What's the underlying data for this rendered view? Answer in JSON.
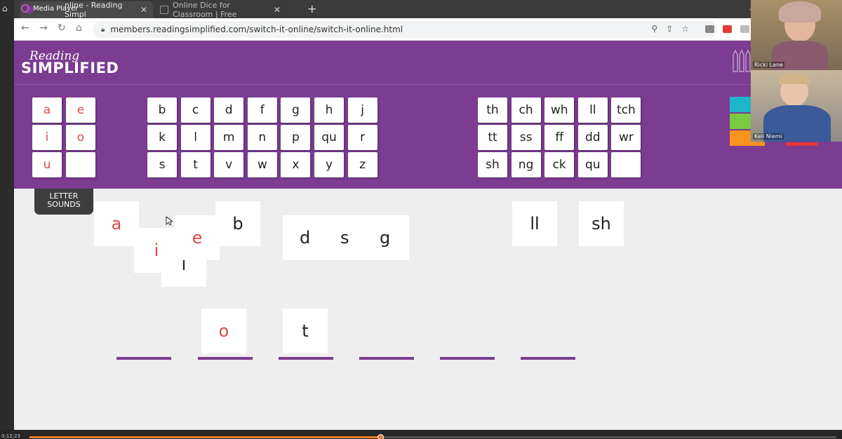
{
  "media_player": {
    "title": "Media Player",
    "timestamp": "0:12:23",
    "progress_percent": 43.5
  },
  "browser": {
    "tabs": [
      {
        "label": "nline - Reading Simpl",
        "active": true
      },
      {
        "label": "Online Dice for Classroom | Free",
        "active": false
      }
    ],
    "url": "members.readingsimplified.com/switch-it-online/switch-it-online.html",
    "new_tab_label": "+"
  },
  "app": {
    "logo_top": "Reading",
    "logo_main": "SIMPLIFIED",
    "vowels": [
      "a",
      "e",
      "i",
      "o",
      "u",
      ""
    ],
    "consonants": [
      [
        "b",
        "c",
        "d",
        "f",
        "g",
        "h",
        "j"
      ],
      [
        "k",
        "l",
        "m",
        "n",
        "p",
        "qu",
        "r"
      ],
      [
        "s",
        "t",
        "v",
        "w",
        "x",
        "y",
        "z"
      ]
    ],
    "digraphs": [
      [
        "th",
        "ch",
        "wh",
        "ll",
        "tch"
      ],
      [
        "tt",
        "ss",
        "ff",
        "dd",
        "wr"
      ],
      [
        "sh",
        "ng",
        "ck",
        "qu",
        ""
      ]
    ],
    "letter_sounds_button": "LETTER SOUNDS",
    "swatch_colors": [
      "#1fb5c9",
      "#7ac943",
      "#f7931e"
    ],
    "accent_color": "#7b3c91",
    "vowel_color": "#d94c48"
  },
  "workspace": {
    "cards": {
      "a": "a",
      "i": "i",
      "e": "e",
      "l": "l",
      "b": "b",
      "d": "d",
      "s": "s",
      "g": "g",
      "ll": "ll",
      "sh": "sh",
      "o": "o",
      "t": "t"
    },
    "slot_count": 6
  },
  "video_call": {
    "participants": [
      "Ricki Lane",
      "Keli Niemi"
    ]
  }
}
